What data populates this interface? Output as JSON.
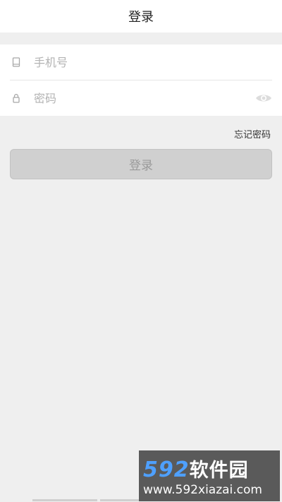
{
  "header": {
    "title": "登录"
  },
  "form": {
    "phone": {
      "placeholder": "手机号",
      "icon": "phone-icon"
    },
    "password": {
      "placeholder": "密码",
      "icon": "lock-icon",
      "toggle_icon": "eye-icon"
    }
  },
  "links": {
    "forgot_password": "忘记密码"
  },
  "buttons": {
    "login": "登录"
  },
  "watermark": {
    "brand_number": "592",
    "brand_text": "软件园",
    "url": "www.592xiazai.com"
  },
  "colors": {
    "background": "#efefef",
    "card": "#ffffff",
    "button_disabled": "#d0d0d0",
    "button_text": "#9a9a9a",
    "watermark_accent": "#4ea0ff"
  }
}
